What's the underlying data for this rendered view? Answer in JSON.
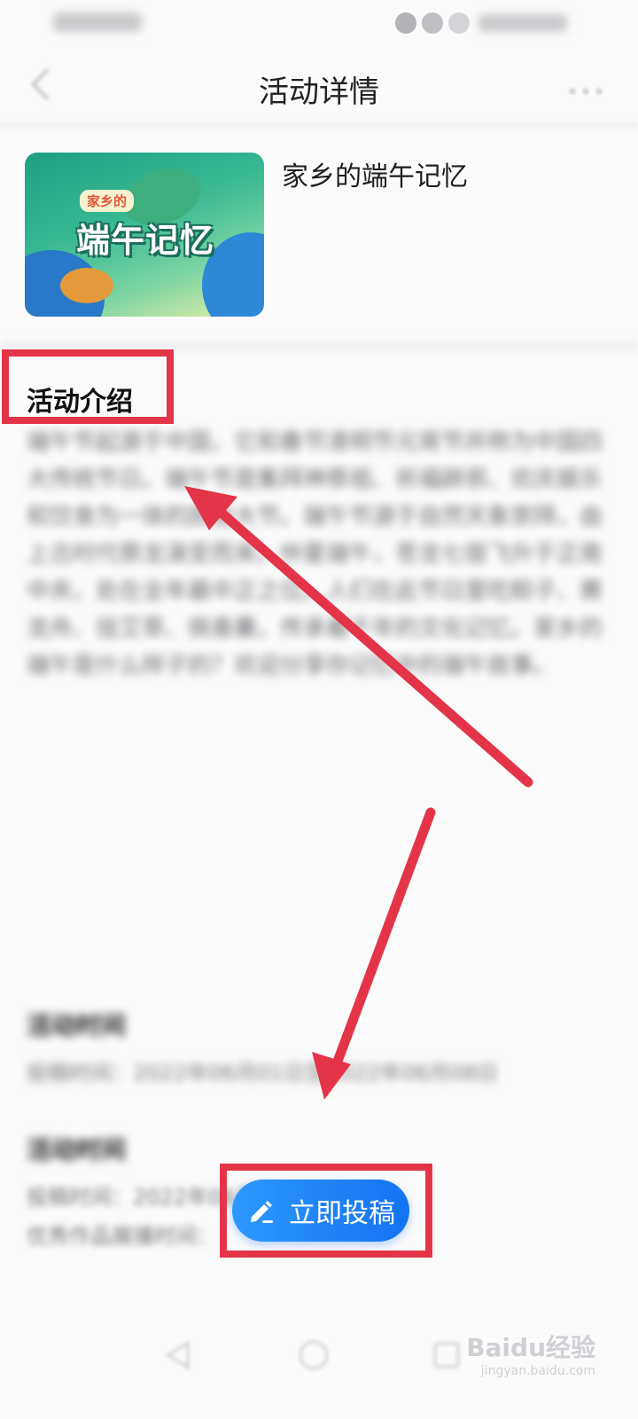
{
  "header": {
    "title": "活动详情"
  },
  "activity": {
    "title": "家乡的端午记忆"
  },
  "banner": {
    "tag": "家乡的",
    "headline": "端午记忆"
  },
  "intro": {
    "heading": "活动介绍",
    "body": "端午节起源于中国，它和春节清明节元宵节并称为中国四大传统节日。端午节是集拜神祭祖、祈福辟邪、欢庆娱乐和饮食为一体的民俗大节。端午节源于自然天象崇拜，由上古时代祭龙演变而来。仲夏端午，苍龙七宿飞升于正南中央，处在全年最中正之位。人们在此节日里吃粽子、赛龙舟、挂艾草、佩香囊，传承着千年的文化记忆。家乡的端午是什么样子的？欢迎分享你记忆中的端午故事。"
  },
  "section2": {
    "heading": "活动时间",
    "body": "投稿时间：2022年06月01日至2022年06月08日"
  },
  "section3": {
    "heading": "活动时间",
    "body1": "投稿时间：2022年06月01日至6月8日",
    "body2": "优秀作品展播时间："
  },
  "cta": {
    "label": "立即投稿"
  },
  "watermark": {
    "brand": "Baidu经验",
    "url": "jingyan.baidu.com"
  },
  "colors": {
    "annotation": "#e43548",
    "button": "#1373f2",
    "background": "#fbfbfc"
  }
}
